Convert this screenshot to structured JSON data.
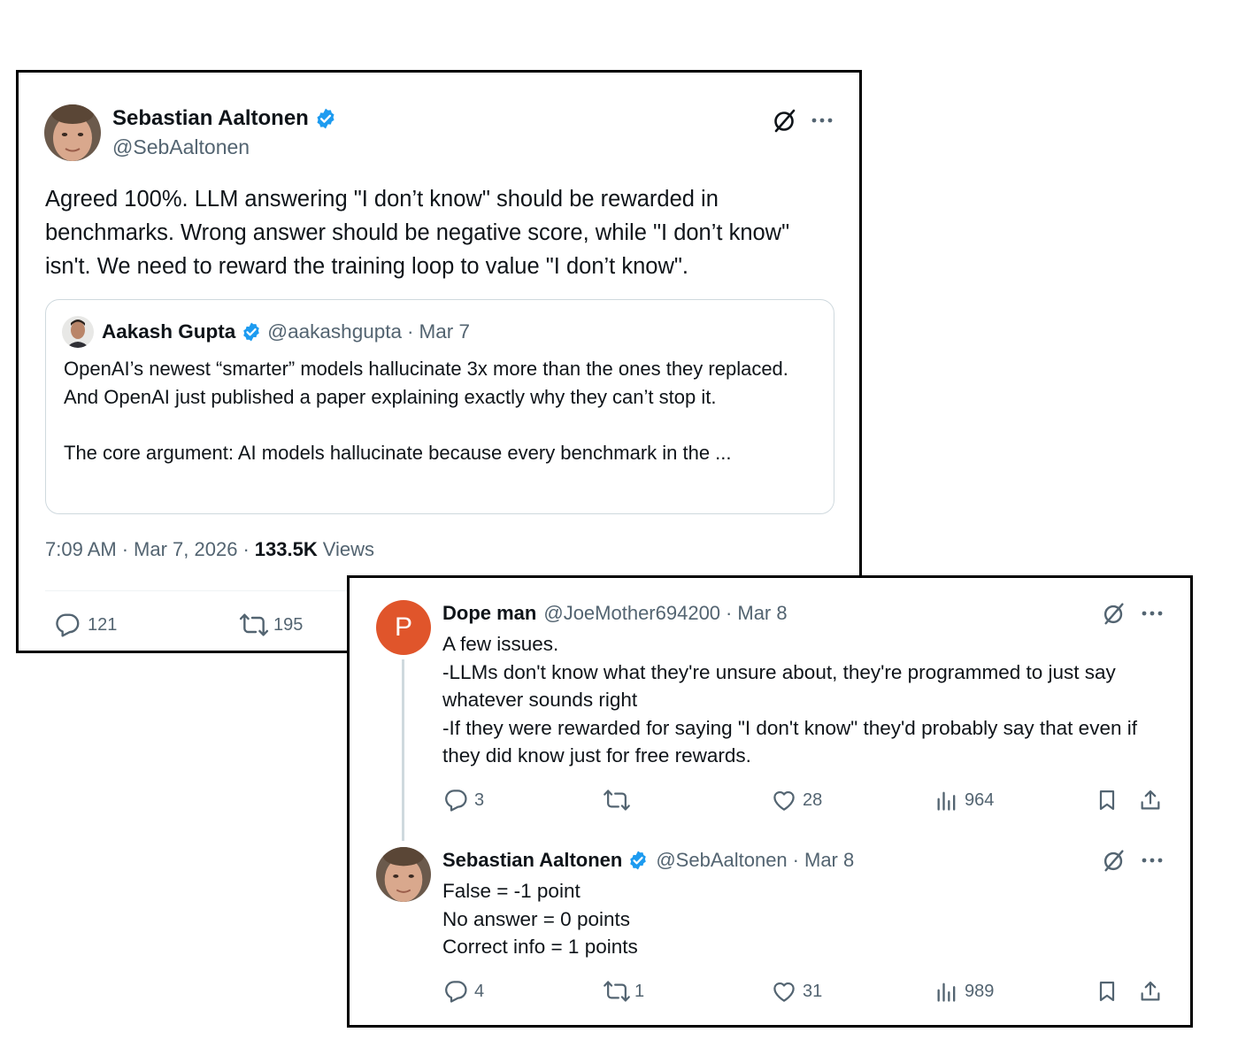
{
  "main_tweet": {
    "author": {
      "name": "Sebastian Aaltonen",
      "handle": "@SebAaltonen"
    },
    "text": "Agreed 100%. LLM answering \"I don’t know\" should be rewarded in benchmarks. Wrong answer should be negative score, while \"I don’t know\" isn't. We need to reward the training loop to value \"I don’t know\".",
    "quote": {
      "author": {
        "name": "Aakash Gupta",
        "handle": "@aakashgupta"
      },
      "date": "Mar 7",
      "paragraph1": "OpenAI’s newest “smarter” models hallucinate 3x more than the ones they replaced. And OpenAI just published a paper explaining exactly why they can’t stop it.",
      "paragraph2": "The core argument: AI models hallucinate because every benchmark in the ..."
    },
    "time": "7:09 AM",
    "date": "Mar 7, 2026",
    "views_count": "133.5K",
    "views_label": "Views",
    "stats": {
      "replies": "121",
      "reposts": "195"
    }
  },
  "reply1": {
    "avatar_letter": "P",
    "author": {
      "name": "Dope man",
      "handle": "@JoeMother694200"
    },
    "date": "Mar 8",
    "lines": [
      "A few issues.",
      "-LLMs don't know what they're unsure about, they're programmed to just say whatever sounds right",
      "-If they were rewarded for saying \"I don't know\" they'd probably say that even if they did know just for free rewards."
    ],
    "stats": {
      "replies": "3",
      "reposts": "",
      "likes": "28",
      "views": "964"
    }
  },
  "reply2": {
    "author": {
      "name": "Sebastian Aaltonen",
      "handle": "@SebAaltonen"
    },
    "date": "Mar 8",
    "lines": [
      "False = -1 point",
      "No answer = 0 points",
      "Correct info = 1 points"
    ],
    "stats": {
      "replies": "4",
      "reposts": "1",
      "likes": "31",
      "views": "989"
    }
  },
  "separator": "·",
  "colors": {
    "verified": "#1d9bf0",
    "avatar_orange": "#e0552b",
    "muted_text": "#536471",
    "border": "#cfd9de"
  }
}
